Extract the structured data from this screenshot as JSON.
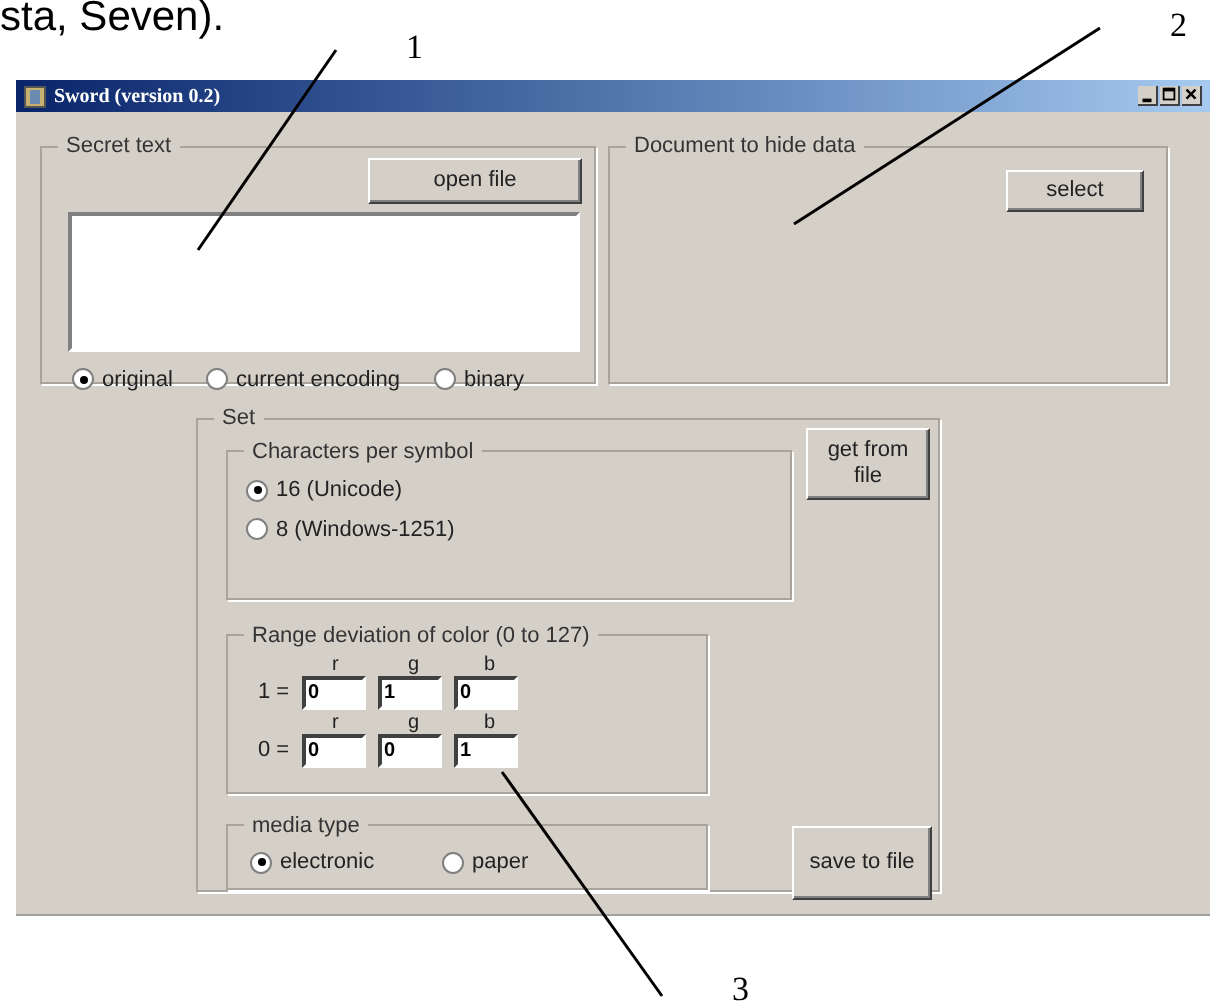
{
  "page_text": "sta, Seven).",
  "callouts": [
    {
      "label": "1"
    },
    {
      "label": "2"
    },
    {
      "label": "3"
    }
  ],
  "window": {
    "title": "Sword (version  0.2)"
  },
  "secret_text": {
    "legend": "Secret text",
    "button": "open file",
    "encodings": [
      {
        "label": "original",
        "selected": true
      },
      {
        "label": "current encoding",
        "selected": false
      },
      {
        "label": "binary",
        "selected": false
      }
    ]
  },
  "document": {
    "legend": "Document to hide data",
    "button": "select"
  },
  "set": {
    "legend": "Set",
    "characters": {
      "legend": "Characters per symbol",
      "options": [
        {
          "label": "16 (Unicode)",
          "selected": true
        },
        {
          "label": "8 (Windows-1251)",
          "selected": false
        }
      ]
    },
    "get_button": "get from file",
    "range": {
      "legend": "Range deviation of color (0 to 127)",
      "rows": [
        {
          "label": "1 =",
          "fields": [
            {
              "channel": "r",
              "value": "0"
            },
            {
              "channel": "g",
              "value": "1"
            },
            {
              "channel": "b",
              "value": "0"
            }
          ]
        },
        {
          "label": "0 =",
          "fields": [
            {
              "channel": "r",
              "value": "0"
            },
            {
              "channel": "g",
              "value": "0"
            },
            {
              "channel": "b",
              "value": "1"
            }
          ]
        }
      ]
    },
    "media": {
      "legend": "media type",
      "options": [
        {
          "label": "electronic",
          "selected": true
        },
        {
          "label": "paper",
          "selected": false
        }
      ]
    },
    "save_button": "save to file"
  }
}
